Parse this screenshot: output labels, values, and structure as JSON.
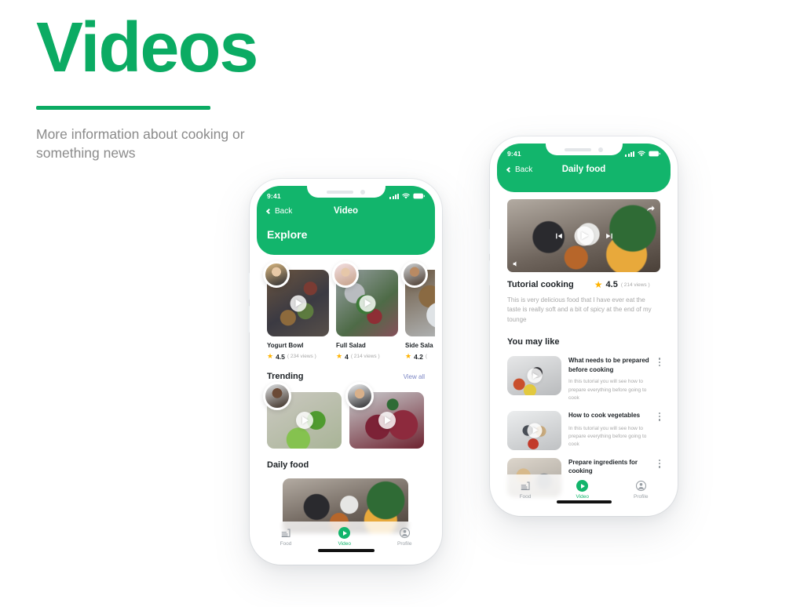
{
  "hero": {
    "title": "Videos",
    "subtitle": "More information about cooking or something news"
  },
  "colors": {
    "accent_green": "#12b56c",
    "title_green": "#0bab63",
    "link_blue": "#7b86c4",
    "star_gold": "#ffb300",
    "text_dark": "#1d2226",
    "text_muted": "#a8a8a8"
  },
  "phone_left": {
    "status": {
      "time": "9:41",
      "signal_icon": "signal-bars-icon",
      "wifi_icon": "wifi-icon",
      "battery_icon": "battery-icon"
    },
    "nav": {
      "back_label": "Back",
      "title": "Video",
      "back_icon": "chevron-left-icon"
    },
    "explore": {
      "heading": "Explore",
      "cards": [
        {
          "title": "Yogurt Bowl",
          "rating": "4.5",
          "views": "( 234 views )",
          "avatar": "fa-blonde",
          "photo": "ph-yogurt"
        },
        {
          "title": "Full Salad",
          "rating": "4",
          "views": "( 214 views )",
          "avatar": "fa-woman2",
          "photo": "ph-salad"
        },
        {
          "title": "Side Sala",
          "rating": "4.2",
          "views": "(",
          "avatar": "fa-man1",
          "photo": "ph-side"
        }
      ]
    },
    "trending": {
      "heading": "Trending",
      "view_all_label": "View all",
      "cards": [
        {
          "avatar": "fa-man2",
          "photo": "ph-green"
        },
        {
          "avatar": "fa-man3",
          "photo": "ph-berry"
        }
      ]
    },
    "daily_food": {
      "heading": "Daily food",
      "photo": "ph-kitchen"
    },
    "tabbar": {
      "tabs": [
        {
          "label": "Food",
          "icon": "food-icon",
          "active": false
        },
        {
          "label": "Video",
          "icon": "video-play-icon",
          "active": true
        },
        {
          "label": "Profile",
          "icon": "profile-icon",
          "active": false
        }
      ]
    }
  },
  "phone_right": {
    "status": {
      "time": "9:41",
      "signal_icon": "signal-bars-icon",
      "wifi_icon": "wifi-icon",
      "battery_icon": "battery-icon"
    },
    "nav": {
      "back_label": "Back",
      "title": "Daily food",
      "back_icon": "chevron-left-icon"
    },
    "player": {
      "photo": "ph-kitchen",
      "share_icon": "share-icon",
      "volume_icon": "volume-icon",
      "prev_icon": "skip-previous-icon",
      "play_icon": "play-icon",
      "next_icon": "skip-next-icon"
    },
    "video_info": {
      "title": "Tutorial cooking",
      "rating": "4.5",
      "views": "( 214 views )",
      "description": "This is very delicious food that I have ever eat the taste is really soft and a bit of spicy at the end of my tounge"
    },
    "you_may_like": {
      "heading": "You may like",
      "items": [
        {
          "title": "What needs to be prepared before cooking",
          "desc": "In this tutorial you will see how to prepare everything before going to cook",
          "photo": "ph-man-kitchen",
          "menu_icon": "kebab-menu-icon"
        },
        {
          "title": "How to cook vegetables",
          "desc": "In this tutorial you will see how to prepare everything before going to cook",
          "photo": "ph-couple",
          "menu_icon": "kebab-menu-icon"
        },
        {
          "title": "Prepare ingredients for cooking",
          "desc": "",
          "photo": "ph-prep",
          "menu_icon": "kebab-menu-icon"
        }
      ]
    },
    "tabbar": {
      "tabs": [
        {
          "label": "Food",
          "icon": "food-icon",
          "active": false
        },
        {
          "label": "Video",
          "icon": "video-play-icon",
          "active": true
        },
        {
          "label": "Profile",
          "icon": "profile-icon",
          "active": false
        }
      ]
    }
  }
}
